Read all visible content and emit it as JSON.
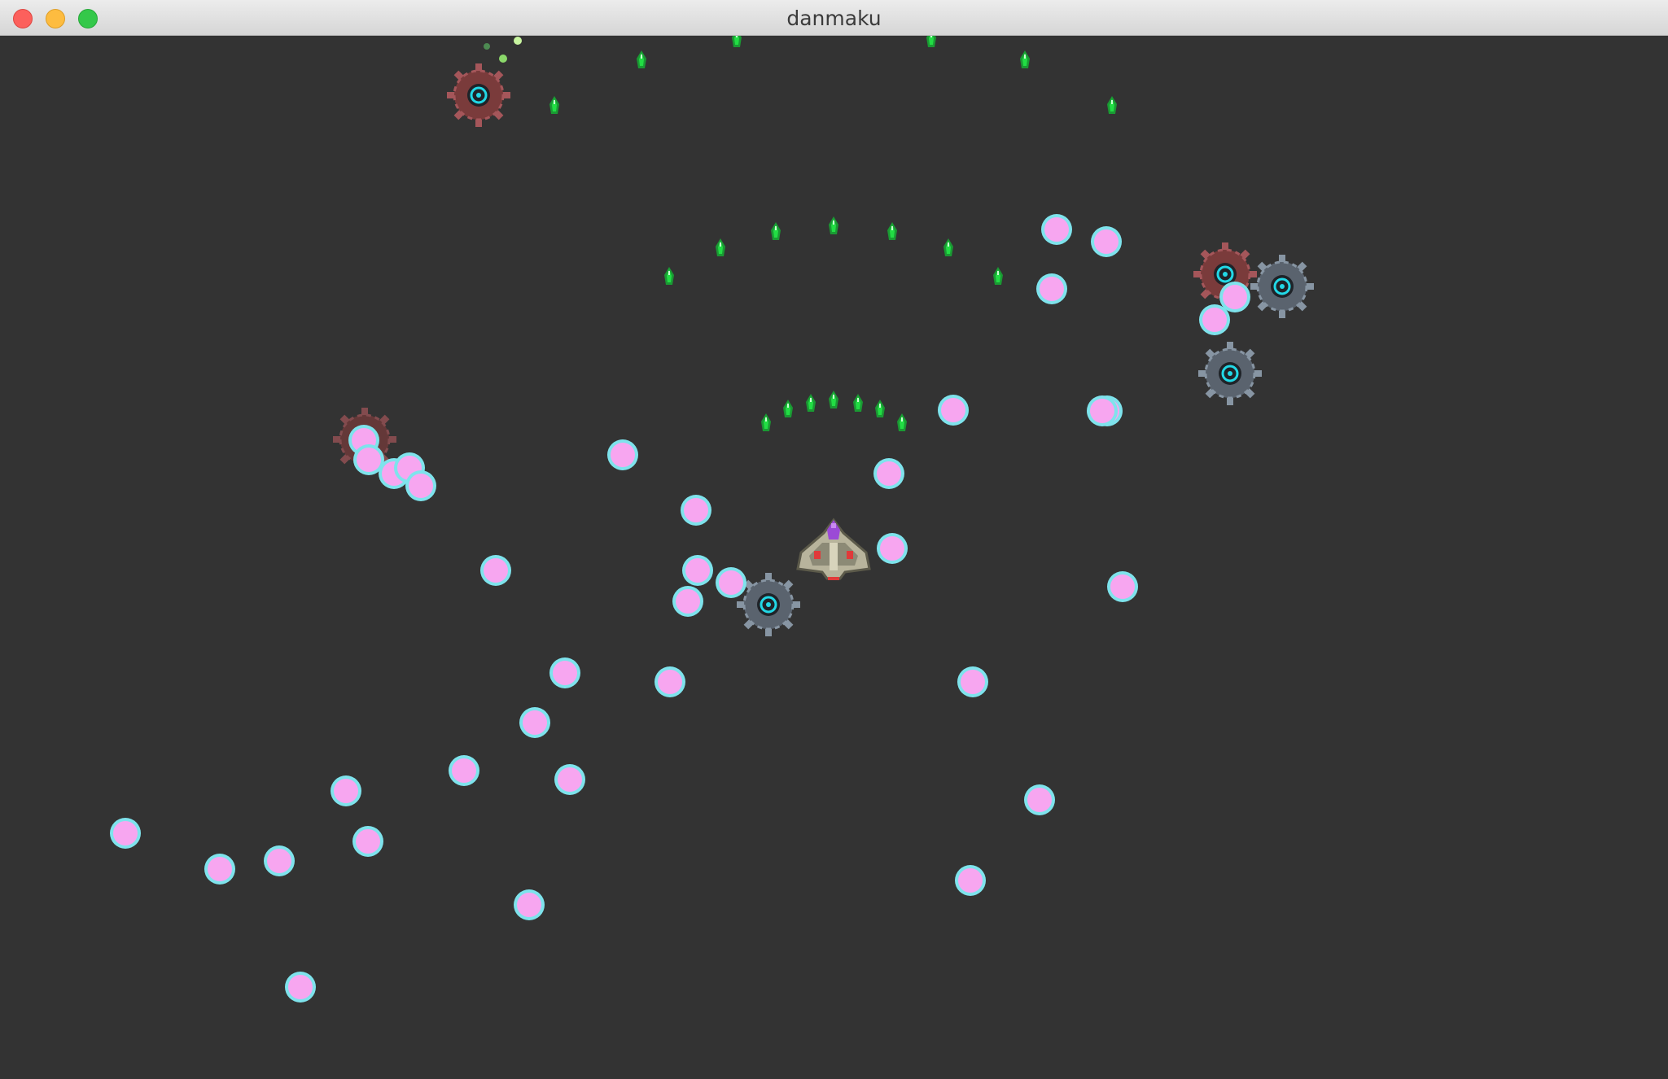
{
  "window": {
    "title": "danmaku",
    "controls": [
      "close",
      "minimize",
      "zoom"
    ]
  },
  "colors": {
    "background": "#333333",
    "bullet_fill": "#f7a6f0",
    "bullet_ring": "#7ee3ec",
    "player_bullet": "#22dd44",
    "enemy_dark": "#5a636e",
    "enemy_red": "#7a3b3b",
    "enemy_core": "#22d8e6"
  }
}
